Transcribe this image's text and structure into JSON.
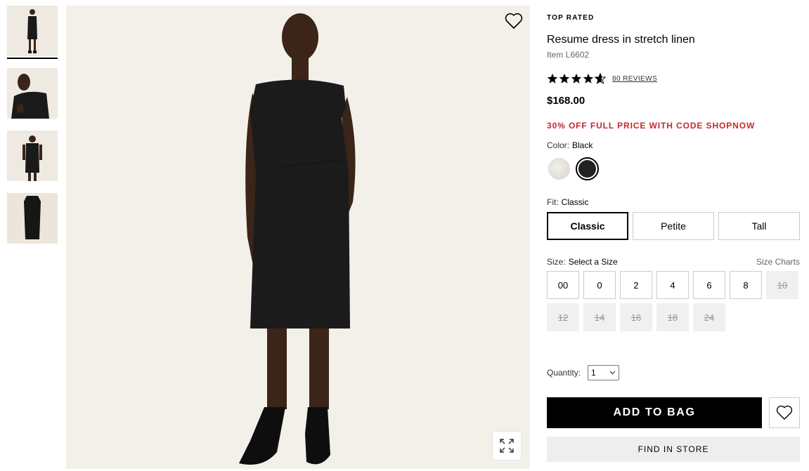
{
  "product": {
    "badge": "TOP RATED",
    "title": "Resume dress in stretch linen",
    "item_number": "Item L6602",
    "rating": 4.5,
    "reviews_label": "80 REVIEWS",
    "price": "$168.00",
    "promo": "30% OFF FULL PRICE WITH CODE SHOPNOW"
  },
  "color": {
    "label": "Color:",
    "selected": "Black",
    "swatches": [
      {
        "name": "ivory",
        "hex": "#e6e2da"
      },
      {
        "name": "black",
        "hex": "#222222"
      }
    ]
  },
  "fit": {
    "label": "Fit:",
    "selected": "Classic",
    "options": [
      "Classic",
      "Petite",
      "Tall"
    ]
  },
  "size": {
    "label": "Size:",
    "selected": "Select a Size",
    "charts_label": "Size Charts",
    "available": [
      "00",
      "0",
      "2",
      "4",
      "6",
      "8"
    ],
    "unavailable": [
      "10",
      "12",
      "14",
      "16",
      "18",
      "24"
    ]
  },
  "quantity": {
    "label": "Quantity:",
    "value": "1"
  },
  "actions": {
    "add_to_bag": "ADD TO BAG",
    "find_in_store": "FIND IN STORE"
  },
  "gallery": {
    "thumbnails": [
      "front-view",
      "portrait-view",
      "back-view",
      "flat-lay-view"
    ],
    "active_index": 0
  },
  "colors": {
    "promo": "#c7282d",
    "primary_button": "#000000",
    "secondary_button": "#eeeeee",
    "image_background": "#f3f0ea"
  }
}
